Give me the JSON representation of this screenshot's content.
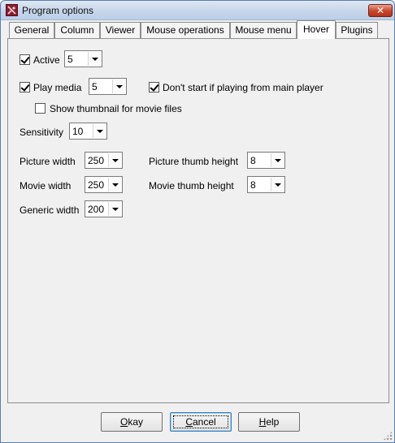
{
  "window": {
    "title": "Program options",
    "close_glyph": "✕"
  },
  "tabs": [
    {
      "label": "General",
      "active": false
    },
    {
      "label": "Column",
      "active": false
    },
    {
      "label": "Viewer",
      "active": false
    },
    {
      "label": "Mouse operations",
      "active": false
    },
    {
      "label": "Mouse menu",
      "active": false
    },
    {
      "label": "Hover",
      "active": true
    },
    {
      "label": "Plugins",
      "active": false
    }
  ],
  "hover": {
    "active": {
      "label": "Active",
      "checked": true,
      "value": "5"
    },
    "play_media": {
      "label": "Play media",
      "checked": true,
      "value": "5"
    },
    "dont_start": {
      "label": "Don't start if playing from main player",
      "checked": true
    },
    "show_thumbnail": {
      "label": "Show thumbnail for movie files",
      "checked": false
    },
    "sensitivity": {
      "label": "Sensitivity",
      "value": "10"
    },
    "picture_width": {
      "label": "Picture width",
      "value": "250"
    },
    "movie_width": {
      "label": "Movie width",
      "value": "250"
    },
    "generic_width": {
      "label": "Generic width",
      "value": "200"
    },
    "picture_thumb_height": {
      "label": "Picture thumb height",
      "value": "8"
    },
    "movie_thumb_height": {
      "label": "Movie thumb height",
      "value": "8"
    }
  },
  "buttons": {
    "okay": {
      "accel": "O",
      "rest": "kay"
    },
    "cancel": {
      "accel": "C",
      "rest": "ancel"
    },
    "help": {
      "accel": "H",
      "rest": "elp"
    }
  }
}
